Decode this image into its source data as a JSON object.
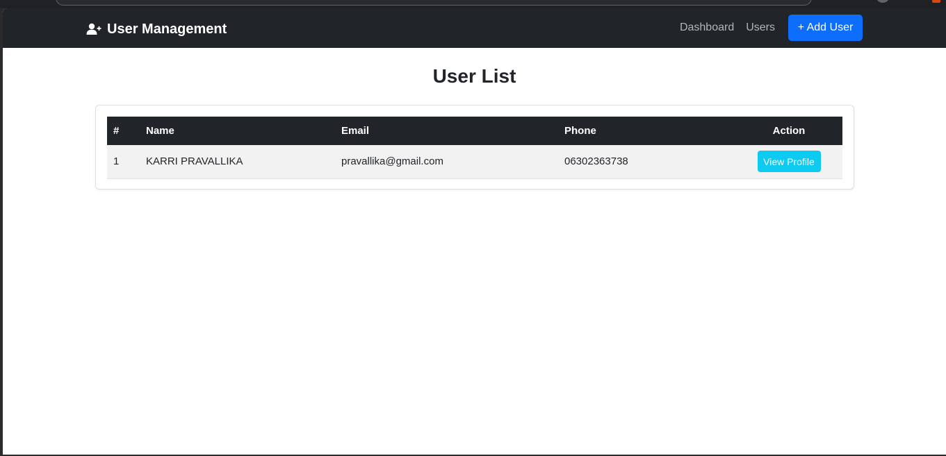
{
  "navbar": {
    "brand": "User Management",
    "brand_icon": "user-plus-icon",
    "links": [
      "Dashboard",
      "Users"
    ],
    "add_user_label": "+ Add User",
    "bg_color": "#212529",
    "primary_color": "#0d6efd"
  },
  "page": {
    "title": "User List"
  },
  "table": {
    "headers": [
      "#",
      "Name",
      "Email",
      "Phone",
      "Action"
    ],
    "rows": [
      {
        "num": "1",
        "name": "KARRI PRAVALLIKA",
        "email": "pravallika@gmail.com",
        "phone": "06302363738",
        "action_label": "View Profile"
      }
    ],
    "action_color": "#0dcaf0"
  }
}
